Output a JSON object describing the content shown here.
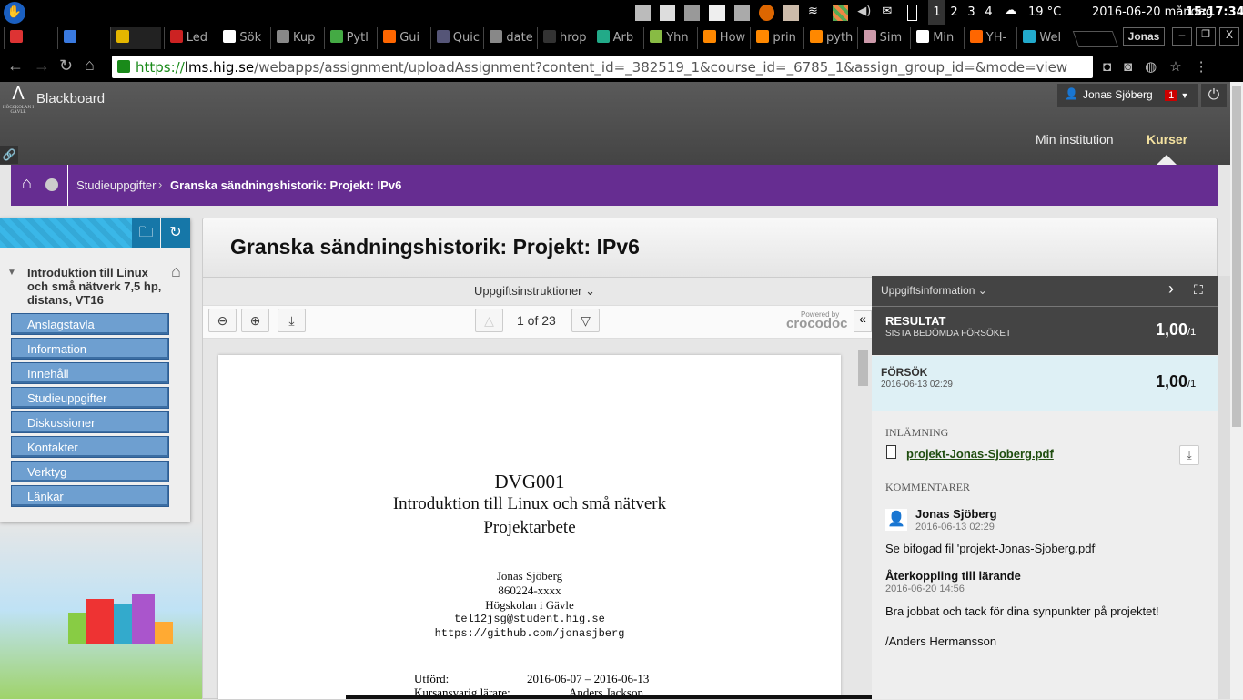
{
  "os": {
    "workspaces": [
      "1",
      "2",
      "3",
      "4"
    ],
    "weather": "19 °C",
    "date": "2016-06-20 måndag",
    "time": "15:17:34"
  },
  "tabs": [
    {
      "label": "",
      "c": "#d33"
    },
    {
      "label": "",
      "c": "#3a7ae0"
    },
    {
      "label": "",
      "c": "#e4b600"
    },
    {
      "label": "Led",
      "c": "#c22"
    },
    {
      "label": "Sök",
      "c": "#fff"
    },
    {
      "label": "Kup",
      "c": "#888"
    },
    {
      "label": "Pytl",
      "c": "#4a4"
    },
    {
      "label": "Gui",
      "c": "#f60"
    },
    {
      "label": "Quic",
      "c": "#557"
    },
    {
      "label": "date",
      "c": "#888"
    },
    {
      "label": "hrop",
      "c": "#333"
    },
    {
      "label": "Arb",
      "c": "#2a8"
    },
    {
      "label": "Yhn",
      "c": "#8b4"
    },
    {
      "label": "How",
      "c": "#f80"
    },
    {
      "label": "prin",
      "c": "#f80"
    },
    {
      "label": "pyth",
      "c": "#f80"
    },
    {
      "label": "Sim",
      "c": "#c9a"
    },
    {
      "label": "Min",
      "c": "#fff"
    },
    {
      "label": "YH-",
      "c": "#f60"
    },
    {
      "label": "Wel",
      "c": "#2ac"
    }
  ],
  "browser_user": "Jonas",
  "url": {
    "scheme": "https://",
    "host": "lms.hig.se",
    "path": "/webapps/assignment/uploadAssignment?content_id=_382519_1&course_id=_6785_1&assign_group_id=&mode=view"
  },
  "header": {
    "brand": "Blackboard",
    "logo_text": "HÖGSKOLAN I GÄVLE",
    "user": "Jonas Sjöberg",
    "notifications": "1",
    "nav": [
      "Min institution",
      "Kurser"
    ]
  },
  "breadcrumb": {
    "parent": "Studieuppgifter",
    "current": "Granska sändningshistorik: Projekt: IPv6"
  },
  "course": {
    "title": "Introduktion till Linux och små nätverk 7,5 hp, distans, VT16",
    "menu": [
      "Anslagstavla",
      "Information",
      "Innehåll",
      "Studieuppgifter",
      "Diskussioner",
      "Kontakter",
      "Verktyg",
      "Länkar"
    ]
  },
  "page_title": "Granska sändningshistorik: Projekt: IPv6",
  "viewer": {
    "instructions": "Uppgiftsinstruktioner",
    "page": "1 of 23",
    "powered": "Powered by",
    "brand": "crocodoc"
  },
  "doc": {
    "code": "DVG001",
    "title": "Introduktion till Linux och små nätverk",
    "subtitle": "Projektarbete",
    "author": "Jonas Sjöberg",
    "id": "860224-xxxx",
    "school": "Högskolan i Gävle",
    "email": "tel12jsg@student.hig.se",
    "github": "https://github.com/jonasjberg",
    "done_label": "Utförd:",
    "done": "2016-06-07 – 2016-06-13",
    "teacher_label": "Kursansvarig lärare:",
    "teacher": "Anders Jackson"
  },
  "info": {
    "header": "Uppgiftsinformation",
    "result_label": "RESULTAT",
    "result_sub": "SISTA BEDÖMDA FÖRSÖKET",
    "score": "1,00",
    "max": "/1",
    "attempt_label": "FÖRSÖK",
    "attempt_date": "2016-06-13 02:29",
    "attempt_score": "1,00",
    "attempt_max": "/1",
    "submission_label": "INLÄMNING",
    "file": "projekt-Jonas-Sjoberg.pdf",
    "comments_label": "KOMMENTARER",
    "comment_author": "Jonas Sjöberg",
    "comment_date": "2016-06-13 02:29",
    "comment_text": "Se bifogad fil 'projekt-Jonas-Sjoberg.pdf'",
    "feedback_label": "Återkoppling till lärande",
    "feedback_date": "2016-06-20 14:56",
    "feedback_text": "Bra jobbat och tack för dina synpunkter på projektet!",
    "feedback_sign": "/Anders Hermansson"
  }
}
